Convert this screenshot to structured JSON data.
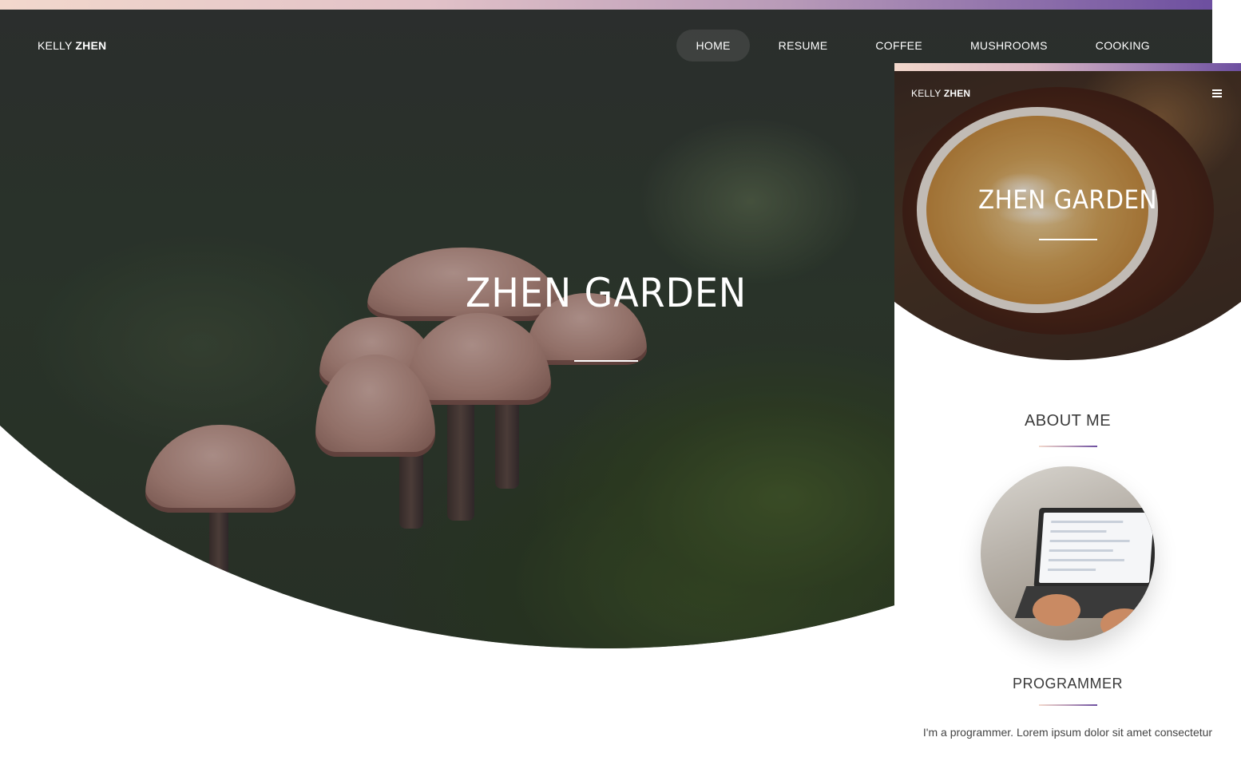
{
  "desktop": {
    "brand": {
      "first": "KELLY",
      "last": "ZHEN"
    },
    "nav": [
      {
        "label": "HOME",
        "active": true
      },
      {
        "label": "RESUME",
        "active": false
      },
      {
        "label": "COFFEE",
        "active": false
      },
      {
        "label": "MUSHROOMS",
        "active": false
      },
      {
        "label": "COOKING",
        "active": false
      }
    ],
    "hero_title": "ZHEN GARDEN"
  },
  "mobile": {
    "brand": {
      "first": "KELLY",
      "last": "ZHEN"
    },
    "menu_icon": "hamburger-icon",
    "hero_title": "ZHEN GARDEN",
    "about_heading": "ABOUT ME",
    "role_heading": "PROGRAMMER",
    "bio": "I'm a programmer. Lorem ipsum dolor sit amet consectetur"
  },
  "colors": {
    "gradient_start": "#f2d8cc",
    "gradient_end": "#6d4fa0",
    "text_dark": "#3a3a3a"
  }
}
